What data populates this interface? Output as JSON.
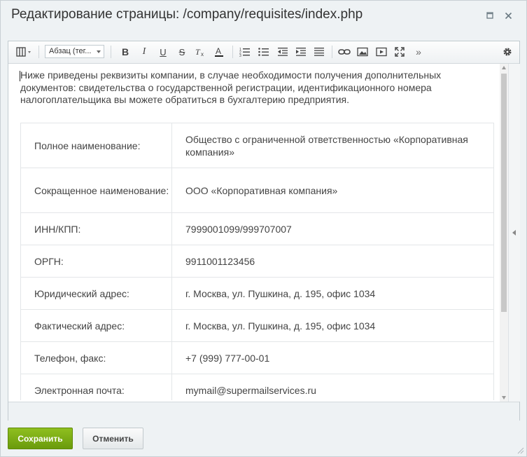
{
  "dialog": {
    "title": "Редактирование страницы: /company/requisites/index.php"
  },
  "toolbar": {
    "format_select": "Абзац (тег...",
    "buttons": [
      "layout-toggle",
      "bold",
      "italic",
      "underline",
      "strikethrough",
      "remove-format",
      "font-color",
      "ordered-list",
      "unordered-list",
      "outdent",
      "indent",
      "justify",
      "link",
      "image",
      "video",
      "fullscreen",
      "more",
      "settings"
    ]
  },
  "content": {
    "intro": "Ниже приведены реквизиты компании, в случае необходимости получения дополнительных документов: свидетельства о государственной регистрации, идентификационного номера налогоплательщика вы можете обратиться в бухгалтерию предприятия.",
    "rows": [
      {
        "key": "Полное наименование:",
        "value": "Общество с ограниченной ответственностью «Корпоративная компания»"
      },
      {
        "key": "Сокращенное наименование:",
        "value": "ООО «Корпоративная компания»"
      },
      {
        "key": "ИНН/КПП:",
        "value": "7999001099/999707007"
      },
      {
        "key": "ОРГН:",
        "value": "9911001123456"
      },
      {
        "key": "Юридический адрес:",
        "value": "г. Москва, ул. Пушкина, д. 195, офис 1034"
      },
      {
        "key": "Фактический адрес:",
        "value": "г. Москва, ул. Пушкина, д. 195, офис 1034"
      },
      {
        "key": "Телефон, факс:",
        "value": "+7 (999) 777-00-01"
      },
      {
        "key": "Электронная почта:",
        "value": "mymail@supermailservices.ru"
      }
    ]
  },
  "footer": {
    "save_label": "Сохранить",
    "cancel_label": "Отменить"
  },
  "colors": {
    "save_button": "#7aab12",
    "background": "#eef2f4"
  }
}
